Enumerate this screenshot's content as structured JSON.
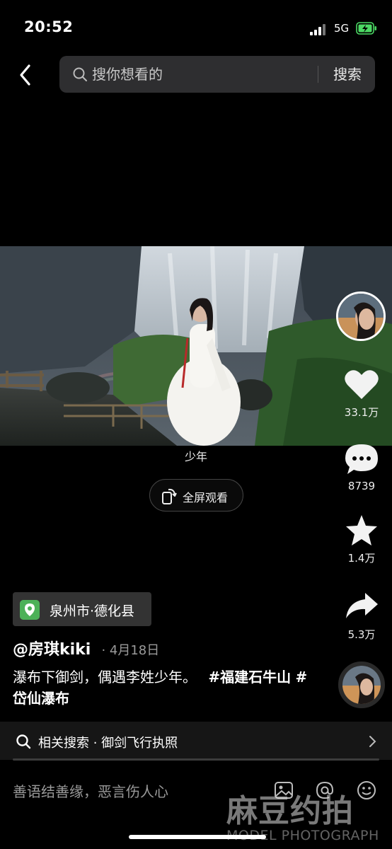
{
  "status_bar": {
    "time": "20:52",
    "network": "5G",
    "battery_icon": "charging-battery-icon"
  },
  "header": {
    "back_icon": "chevron-left-icon",
    "search_placeholder": "搜你想看的",
    "search_button": "搜索"
  },
  "video": {
    "caption": "少年",
    "fullscreen_label": "全屏观看",
    "description_of_scene": null
  },
  "rail": {
    "like_count": "33.1万",
    "comment_count": "8739",
    "favorite_count": "1.4万",
    "share_count": "5.3万"
  },
  "info": {
    "location": "泉州市·德化县",
    "author": "@房琪kiki",
    "date": "· 4月18日",
    "description_text": "瀑布下御剑，偶遇李姓少年。",
    "hashtags": [
      "#福建石牛山",
      "#岱仙瀑布"
    ]
  },
  "related_search": {
    "label": "相关搜索 · 御剑飞行执照"
  },
  "playback": {
    "progress": 0.0
  },
  "comment": {
    "placeholder": "善语结善缘，恶言伤人心"
  },
  "watermark": {
    "main": "麻豆约拍",
    "sub": "MODEL PHOTOGRAPH"
  },
  "colors": {
    "location_green": "#4cb158",
    "background": "#000000",
    "search_bg": "#2e2e30"
  }
}
